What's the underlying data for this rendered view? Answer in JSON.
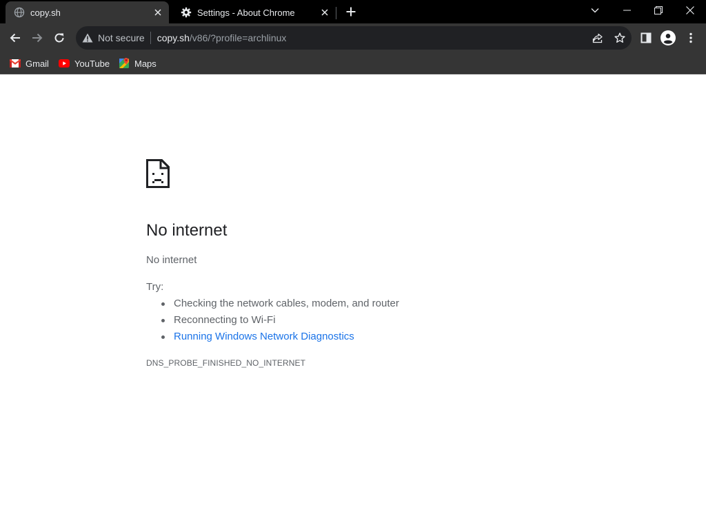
{
  "tabs": [
    {
      "title": "copy.sh",
      "active": true,
      "favicon": "globe-icon"
    },
    {
      "title": "Settings - About Chrome",
      "active": false,
      "favicon": "gear-icon"
    }
  ],
  "toolbar": {
    "security_label": "Not secure",
    "url_host": "copy.sh",
    "url_path": "/v86/?profile=archlinux"
  },
  "bookmarks": [
    {
      "label": "Gmail",
      "icon": "gmail-icon"
    },
    {
      "label": "YouTube",
      "icon": "youtube-icon"
    },
    {
      "label": "Maps",
      "icon": "maps-icon"
    }
  ],
  "error_page": {
    "icon": "sad-page-icon",
    "heading": "No internet",
    "subheading": "No internet",
    "try_label": "Try:",
    "suggestions": [
      "Checking the network cables, modem, and router",
      "Reconnecting to Wi-Fi",
      "Running Windows Network Diagnostics"
    ],
    "error_code": "DNS_PROBE_FINISHED_NO_INTERNET"
  },
  "colors": {
    "tabstrip_bg": "#000000",
    "toolbar_bg": "#353535",
    "omnibox_bg": "#202124",
    "link": "#1a73e8",
    "error_text": "#5f6368",
    "heading_text": "#202124"
  }
}
